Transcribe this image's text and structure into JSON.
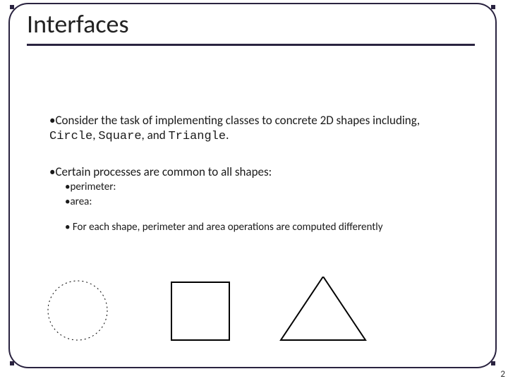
{
  "title": "Interfaces",
  "bullets": {
    "consider_pre": "Consider the task of implementing classes to  concrete 2D shapes including, ",
    "circle": "Circle",
    "sep1": ", ",
    "square": "Square",
    "sep2": ", and ",
    "triangle": "Triangle",
    "period": ".",
    "common": "Certain processes are common to all shapes:",
    "perimeter": "perimeter:",
    "area": "area:",
    "foreach": "For each shape, perimeter and area  operations are computed differently"
  },
  "page_number": "2",
  "bullet_glyph": "• "
}
